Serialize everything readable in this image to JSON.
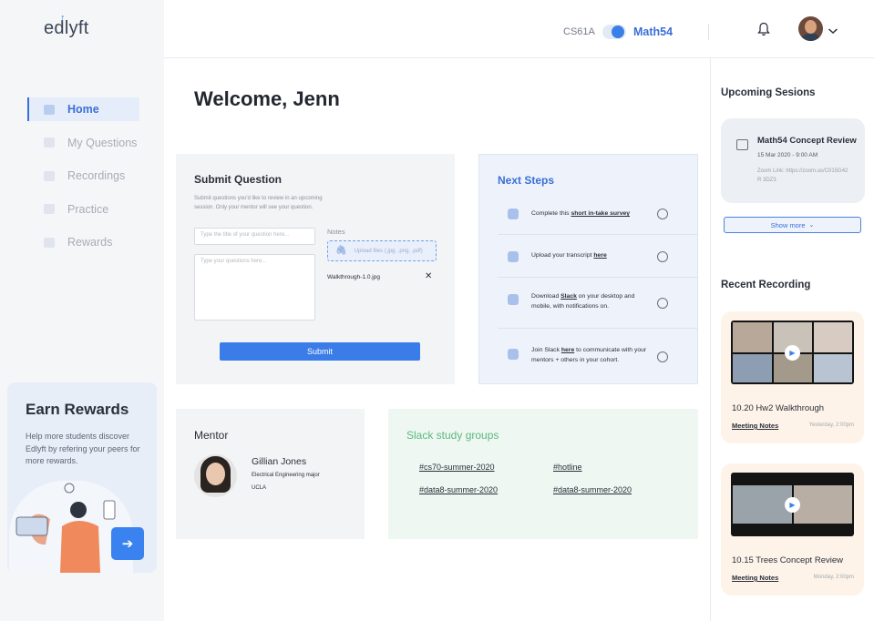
{
  "brand": {
    "logo_text": "edlyft"
  },
  "sidebar": {
    "items": [
      {
        "label": "Home",
        "icon": "home-icon",
        "active": true
      },
      {
        "label": "My Questions",
        "icon": "questions-icon",
        "active": false
      },
      {
        "label": "Recordings",
        "icon": "recordings-icon",
        "active": false
      },
      {
        "label": "Practice",
        "icon": "practice-icon",
        "active": false
      },
      {
        "label": "Rewards",
        "icon": "rewards-icon",
        "active": false
      }
    ],
    "earn": {
      "title": "Earn Rewards",
      "text": "Help more students discover Edlyft by refering your peers for more rewards."
    }
  },
  "topbar": {
    "course_left": "CS61A",
    "course_right": "Math54",
    "toggle_on": true
  },
  "main": {
    "welcome": "Welcome, Jenn",
    "submit": {
      "title": "Submit Question",
      "desc": "Submit questions you'd like to review in an upcoming session. Only your mentor will see your question.",
      "title_placeholder": "Type the title of your question here...",
      "body_placeholder": "Type your questions here...",
      "notes_label": "Notes",
      "upload_label": "Upload files (.jpg, .png, .pdf)",
      "file_name": "Walkthrough-1.0.jpg",
      "remove_glyph": "✕",
      "button": "Submit"
    },
    "next_steps": {
      "title": "Next Steps",
      "items": [
        {
          "pre": "Complete this ",
          "link": "short in-take survey",
          "post": ""
        },
        {
          "pre": "Upload your transcript ",
          "link": "here",
          "post": ""
        },
        {
          "pre": "Download ",
          "link": "Slack",
          "post": " on your desktop and mobile, with notifications on."
        },
        {
          "pre": "Join Slack ",
          "link": "here",
          "post": " to communicate with your mentors + others in your cohort."
        }
      ]
    },
    "mentor": {
      "title": "Mentor",
      "name": "Gillian Jones",
      "major": "Electrical Engineering major",
      "school": "UCLA"
    },
    "slack": {
      "title": "Slack study groups",
      "tags": [
        "#cs70-summer-2020",
        "#hotline",
        "#data8-summer-2020",
        "#data8-summer-2020"
      ]
    }
  },
  "right": {
    "upcoming_title": "Upcoming Sesions",
    "session": {
      "title": "Math54 Concept Review",
      "date": "15 Mar 2020 - 9:00 AM",
      "zoom": "Zoom Link: https://zoom.us/C015G42R 3DZ3"
    },
    "show_more": "Show more",
    "recent_title": "Recent Recording",
    "recordings": [
      {
        "title": "10.20 Hw2 Walkthrough",
        "notes": "Meeting Notes",
        "date": "Yesterday, 2:00pm"
      },
      {
        "title": "10.15 Trees Concept Review",
        "notes": "Meeting Notes",
        "date": "Monday, 2:00pm"
      }
    ]
  },
  "colors": {
    "accent": "#3a7de8",
    "slack_green": "#5cb87f",
    "rec_card": "#fdf3e8"
  }
}
